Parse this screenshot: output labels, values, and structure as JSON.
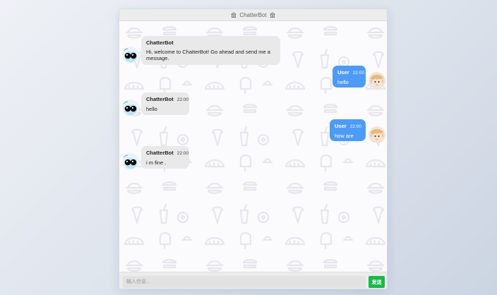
{
  "header": {
    "title": "ChatterBot",
    "left_icon": "building-icon",
    "right_icon": "building-icon"
  },
  "messages": [
    {
      "sender": "bot",
      "name": "ChatterBot",
      "time": "",
      "text": "Hi, welcome to ChatterBot! Go ahead and send me a message."
    },
    {
      "sender": "user",
      "name": "User",
      "time": "22:00",
      "text": "hello"
    },
    {
      "sender": "bot",
      "name": "ChatterBot",
      "time": "22:00",
      "text": "hello"
    },
    {
      "sender": "user",
      "name": "User",
      "time": "22:00",
      "text": "how are you"
    },
    {
      "sender": "bot",
      "name": "ChatterBot",
      "time": "22:00",
      "text": "i m fine ."
    }
  ],
  "composer": {
    "placeholder": "输入信息...",
    "send_label": "发送"
  },
  "colors": {
    "user_bubble": "#4e9bf5",
    "bot_bubble": "#e9e9e9",
    "send_button": "#1bb84b"
  }
}
